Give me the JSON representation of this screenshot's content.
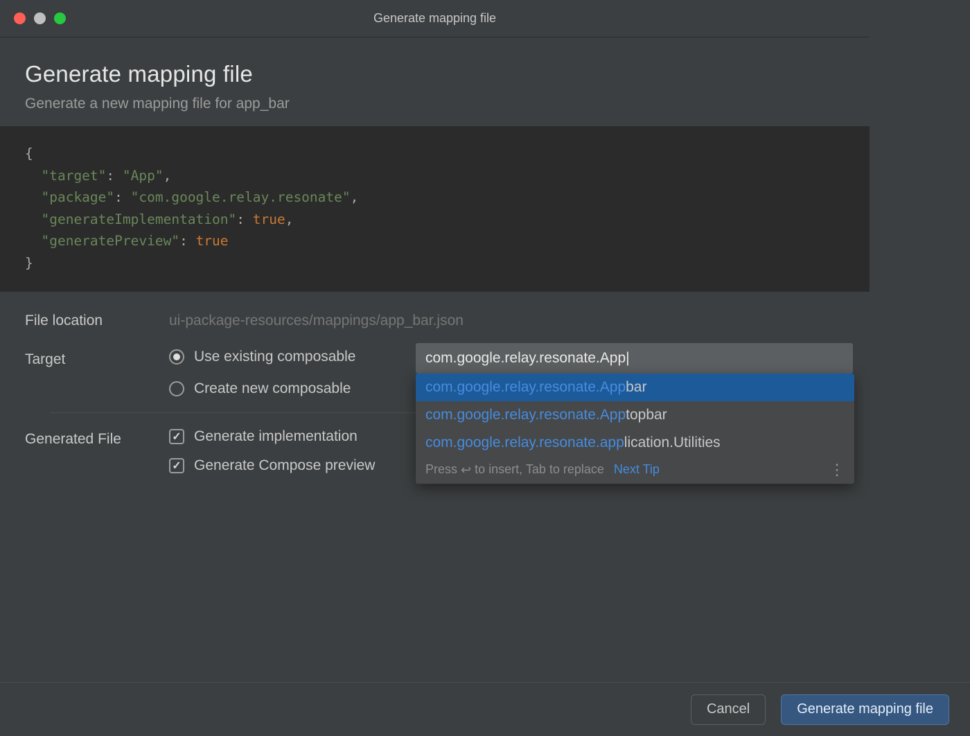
{
  "window": {
    "title": "Generate mapping file"
  },
  "header": {
    "title": "Generate mapping file",
    "subtitle": "Generate a new mapping file for app_bar"
  },
  "code": {
    "open": "{",
    "l1": {
      "key": "\"target\"",
      "colon": ": ",
      "val": "\"App\"",
      "comma": ","
    },
    "l2": {
      "key": "\"package\"",
      "colon": ": ",
      "val": "\"com.google.relay.resonate\"",
      "comma": ","
    },
    "l3": {
      "key": "\"generateImplementation\"",
      "colon": ": ",
      "val": "true",
      "comma": ","
    },
    "l4": {
      "key": "\"generatePreview\"",
      "colon": ": ",
      "val": "true"
    },
    "close": "}"
  },
  "form": {
    "file_location": {
      "label": "File location",
      "value": "ui-package-resources/mappings/app_bar.json"
    },
    "target": {
      "label": "Target",
      "options": {
        "existing": "Use existing composable",
        "create": "Create new composable"
      },
      "input_value": "com.google.relay.resonate.App|"
    },
    "generated": {
      "label": "Generated File",
      "impl": "Generate implementation",
      "preview": "Generate Compose preview"
    }
  },
  "autocomplete": {
    "items": [
      {
        "match": "com.google.relay.resonate.App",
        "rest": "bar"
      },
      {
        "match": "com.google.relay.resonate.App",
        "rest": "topbar"
      },
      {
        "match": "com.google.relay.resonate.app",
        "rest": "lication.Utilities"
      }
    ],
    "hint_pre": "Press ",
    "hint_post": " to insert, Tab to replace",
    "tip": "Next Tip"
  },
  "buttons": {
    "cancel": "Cancel",
    "generate": "Generate mapping file"
  }
}
